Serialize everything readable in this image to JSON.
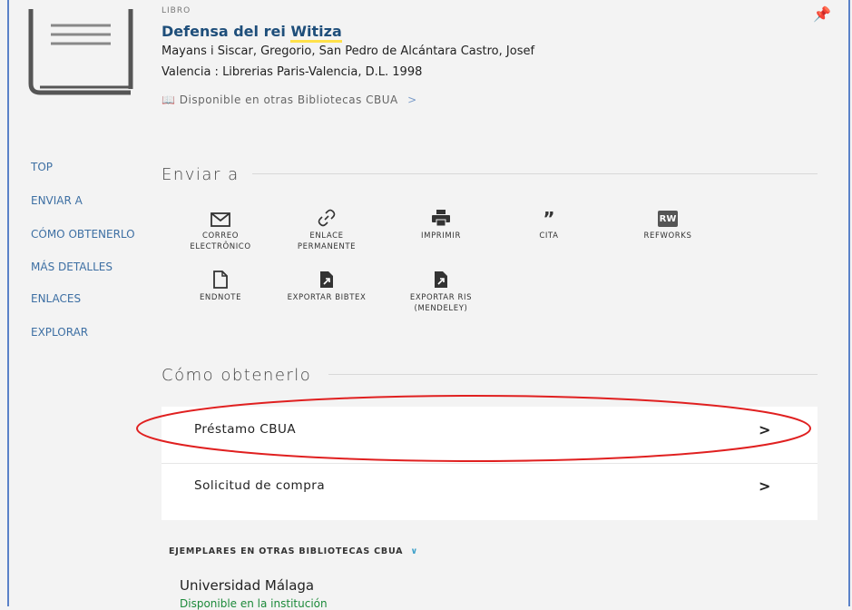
{
  "record": {
    "type": "LIBRO",
    "title_prefix": "Defensa del rei ",
    "title_highlight": "Witiza",
    "author": "Mayans i Siscar, Gregorio, San Pedro de Alcántara Castro, Josef",
    "publication": "Valencia : Librerias Paris-Valencia, D.L. 1998",
    "availability": "Disponible en otras Bibliotecas CBUA",
    "availability_arrow": ">"
  },
  "nav": [
    {
      "label": "TOP"
    },
    {
      "label": "ENVIAR A"
    },
    {
      "label": "CÓMO OBTENERLO"
    },
    {
      "label": "MÁS DETALLES"
    },
    {
      "label": "ENLACES"
    },
    {
      "label": "EXPLORAR"
    }
  ],
  "send_to": {
    "title": "Enviar a",
    "actions": [
      {
        "icon": "mail-icon",
        "label": "CORREO ELECTRÔNICO"
      },
      {
        "icon": "link-icon",
        "label": "ENLACE PERMANENTE"
      },
      {
        "icon": "print-icon",
        "label": "IMPRIMIR"
      },
      {
        "icon": "quote-icon",
        "label": "CITA"
      },
      {
        "icon": "refworks-icon",
        "label": "REFWORKS",
        "badge": "RW"
      },
      {
        "icon": "file-icon",
        "label": "ENDNOTE"
      },
      {
        "icon": "export-icon",
        "label": "EXPORTAR BIBTEX"
      },
      {
        "icon": "export-icon",
        "label": "EXPORTAR RIS (MENDELEY)"
      }
    ]
  },
  "how_to_get": {
    "title": "Cómo obtenerlo",
    "options": [
      {
        "label": "Préstamo CBUA",
        "chevron": ">"
      },
      {
        "label": "Solicitud de compra",
        "chevron": ">"
      }
    ]
  },
  "copies": {
    "header": "EJEMPLARES EN OTRAS BIBLIOTECAS CBUA",
    "library": "Universidad Málaga",
    "status": "Disponible en la institución"
  },
  "colors": {
    "accent": "#3d6fa3",
    "title": "#1e4e7a",
    "highlight": "#ffe14a",
    "annotation": "#e02020",
    "available": "#1c8a3a"
  }
}
